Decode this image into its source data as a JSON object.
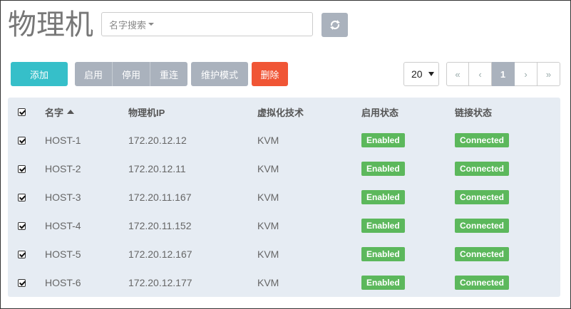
{
  "page": {
    "title": "物理机"
  },
  "search": {
    "placeholder": "名字搜索"
  },
  "toolbar": {
    "add_label": "添加",
    "enable_label": "启用",
    "disable_label": "停用",
    "reconnect_label": "重连",
    "maintenance_label": "维护模式",
    "delete_label": "删除"
  },
  "pagination": {
    "page_size": "20",
    "first": "«",
    "prev": "‹",
    "current": "1",
    "next": "›",
    "last": "»"
  },
  "table": {
    "columns": [
      "名字",
      "物理机IP",
      "虚拟化技术",
      "启用状态",
      "链接状态"
    ],
    "rows": [
      {
        "name": "HOST-1",
        "ip": "172.20.12.12",
        "virt": "KVM",
        "enabled": "Enabled",
        "conn": "Connected"
      },
      {
        "name": "HOST-2",
        "ip": "172.20.12.11",
        "virt": "KVM",
        "enabled": "Enabled",
        "conn": "Connected"
      },
      {
        "name": "HOST-3",
        "ip": "172.20.11.167",
        "virt": "KVM",
        "enabled": "Enabled",
        "conn": "Connected"
      },
      {
        "name": "HOST-4",
        "ip": "172.20.11.152",
        "virt": "KVM",
        "enabled": "Enabled",
        "conn": "Connected"
      },
      {
        "name": "HOST-5",
        "ip": "172.20.12.167",
        "virt": "KVM",
        "enabled": "Enabled",
        "conn": "Connected"
      },
      {
        "name": "HOST-6",
        "ip": "172.20.12.177",
        "virt": "KVM",
        "enabled": "Enabled",
        "conn": "Connected"
      }
    ]
  },
  "colors": {
    "add": "#36bfc9",
    "secondary": "#aab2bd",
    "danger": "#f05535",
    "success": "#5cb85c",
    "table_bg": "#e6ecf3"
  },
  "icons": {
    "refresh": "refresh-icon",
    "sort": "sort-asc-icon",
    "dropdown": "caret-down-icon"
  }
}
